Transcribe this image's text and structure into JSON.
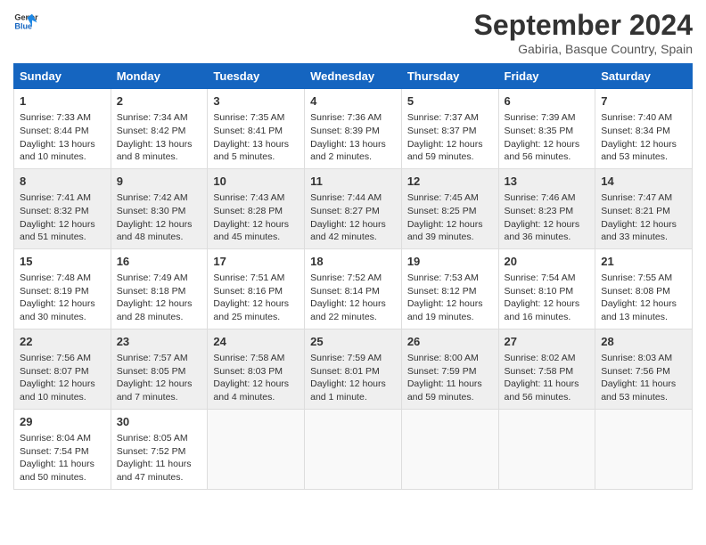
{
  "header": {
    "logo_line1": "General",
    "logo_line2": "Blue",
    "month": "September 2024",
    "location": "Gabiria, Basque Country, Spain"
  },
  "days_of_week": [
    "Sunday",
    "Monday",
    "Tuesday",
    "Wednesday",
    "Thursday",
    "Friday",
    "Saturday"
  ],
  "weeks": [
    [
      {
        "day": "1",
        "sunrise": "Sunrise: 7:33 AM",
        "sunset": "Sunset: 8:44 PM",
        "daylight": "Daylight: 13 hours and 10 minutes."
      },
      {
        "day": "2",
        "sunrise": "Sunrise: 7:34 AM",
        "sunset": "Sunset: 8:42 PM",
        "daylight": "Daylight: 13 hours and 8 minutes."
      },
      {
        "day": "3",
        "sunrise": "Sunrise: 7:35 AM",
        "sunset": "Sunset: 8:41 PM",
        "daylight": "Daylight: 13 hours and 5 minutes."
      },
      {
        "day": "4",
        "sunrise": "Sunrise: 7:36 AM",
        "sunset": "Sunset: 8:39 PM",
        "daylight": "Daylight: 13 hours and 2 minutes."
      },
      {
        "day": "5",
        "sunrise": "Sunrise: 7:37 AM",
        "sunset": "Sunset: 8:37 PM",
        "daylight": "Daylight: 12 hours and 59 minutes."
      },
      {
        "day": "6",
        "sunrise": "Sunrise: 7:39 AM",
        "sunset": "Sunset: 8:35 PM",
        "daylight": "Daylight: 12 hours and 56 minutes."
      },
      {
        "day": "7",
        "sunrise": "Sunrise: 7:40 AM",
        "sunset": "Sunset: 8:34 PM",
        "daylight": "Daylight: 12 hours and 53 minutes."
      }
    ],
    [
      {
        "day": "8",
        "sunrise": "Sunrise: 7:41 AM",
        "sunset": "Sunset: 8:32 PM",
        "daylight": "Daylight: 12 hours and 51 minutes."
      },
      {
        "day": "9",
        "sunrise": "Sunrise: 7:42 AM",
        "sunset": "Sunset: 8:30 PM",
        "daylight": "Daylight: 12 hours and 48 minutes."
      },
      {
        "day": "10",
        "sunrise": "Sunrise: 7:43 AM",
        "sunset": "Sunset: 8:28 PM",
        "daylight": "Daylight: 12 hours and 45 minutes."
      },
      {
        "day": "11",
        "sunrise": "Sunrise: 7:44 AM",
        "sunset": "Sunset: 8:27 PM",
        "daylight": "Daylight: 12 hours and 42 minutes."
      },
      {
        "day": "12",
        "sunrise": "Sunrise: 7:45 AM",
        "sunset": "Sunset: 8:25 PM",
        "daylight": "Daylight: 12 hours and 39 minutes."
      },
      {
        "day": "13",
        "sunrise": "Sunrise: 7:46 AM",
        "sunset": "Sunset: 8:23 PM",
        "daylight": "Daylight: 12 hours and 36 minutes."
      },
      {
        "day": "14",
        "sunrise": "Sunrise: 7:47 AM",
        "sunset": "Sunset: 8:21 PM",
        "daylight": "Daylight: 12 hours and 33 minutes."
      }
    ],
    [
      {
        "day": "15",
        "sunrise": "Sunrise: 7:48 AM",
        "sunset": "Sunset: 8:19 PM",
        "daylight": "Daylight: 12 hours and 30 minutes."
      },
      {
        "day": "16",
        "sunrise": "Sunrise: 7:49 AM",
        "sunset": "Sunset: 8:18 PM",
        "daylight": "Daylight: 12 hours and 28 minutes."
      },
      {
        "day": "17",
        "sunrise": "Sunrise: 7:51 AM",
        "sunset": "Sunset: 8:16 PM",
        "daylight": "Daylight: 12 hours and 25 minutes."
      },
      {
        "day": "18",
        "sunrise": "Sunrise: 7:52 AM",
        "sunset": "Sunset: 8:14 PM",
        "daylight": "Daylight: 12 hours and 22 minutes."
      },
      {
        "day": "19",
        "sunrise": "Sunrise: 7:53 AM",
        "sunset": "Sunset: 8:12 PM",
        "daylight": "Daylight: 12 hours and 19 minutes."
      },
      {
        "day": "20",
        "sunrise": "Sunrise: 7:54 AM",
        "sunset": "Sunset: 8:10 PM",
        "daylight": "Daylight: 12 hours and 16 minutes."
      },
      {
        "day": "21",
        "sunrise": "Sunrise: 7:55 AM",
        "sunset": "Sunset: 8:08 PM",
        "daylight": "Daylight: 12 hours and 13 minutes."
      }
    ],
    [
      {
        "day": "22",
        "sunrise": "Sunrise: 7:56 AM",
        "sunset": "Sunset: 8:07 PM",
        "daylight": "Daylight: 12 hours and 10 minutes."
      },
      {
        "day": "23",
        "sunrise": "Sunrise: 7:57 AM",
        "sunset": "Sunset: 8:05 PM",
        "daylight": "Daylight: 12 hours and 7 minutes."
      },
      {
        "day": "24",
        "sunrise": "Sunrise: 7:58 AM",
        "sunset": "Sunset: 8:03 PM",
        "daylight": "Daylight: 12 hours and 4 minutes."
      },
      {
        "day": "25",
        "sunrise": "Sunrise: 7:59 AM",
        "sunset": "Sunset: 8:01 PM",
        "daylight": "Daylight: 12 hours and 1 minute."
      },
      {
        "day": "26",
        "sunrise": "Sunrise: 8:00 AM",
        "sunset": "Sunset: 7:59 PM",
        "daylight": "Daylight: 11 hours and 59 minutes."
      },
      {
        "day": "27",
        "sunrise": "Sunrise: 8:02 AM",
        "sunset": "Sunset: 7:58 PM",
        "daylight": "Daylight: 11 hours and 56 minutes."
      },
      {
        "day": "28",
        "sunrise": "Sunrise: 8:03 AM",
        "sunset": "Sunset: 7:56 PM",
        "daylight": "Daylight: 11 hours and 53 minutes."
      }
    ],
    [
      {
        "day": "29",
        "sunrise": "Sunrise: 8:04 AM",
        "sunset": "Sunset: 7:54 PM",
        "daylight": "Daylight: 11 hours and 50 minutes."
      },
      {
        "day": "30",
        "sunrise": "Sunrise: 8:05 AM",
        "sunset": "Sunset: 7:52 PM",
        "daylight": "Daylight: 11 hours and 47 minutes."
      },
      null,
      null,
      null,
      null,
      null
    ]
  ]
}
